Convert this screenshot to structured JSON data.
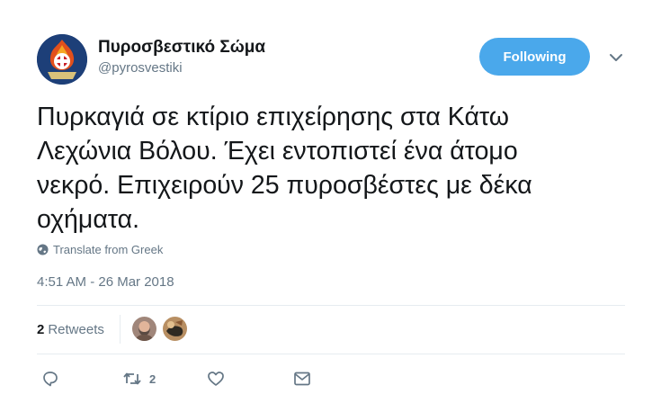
{
  "account": {
    "display_name": "Πυροσβεστικό Σώμα",
    "handle": "@pyrosvestiki"
  },
  "follow_button": {
    "label": "Following",
    "color": "#4aa8eb"
  },
  "tweet": {
    "text": "Πυρκαγιά σε κτίριο επιχείρησης στα Κάτω\nΛεχώνια Βόλου. Έχει εντοπιστεί  ένα άτομο\nνεκρό. Επιχειρούν 25 πυροσβέστες με δέκα\nοχήματα.",
    "translate_label": "Translate from Greek",
    "timestamp": "4:51 AM - 26 Mar 2018"
  },
  "stats": {
    "retweet_count": "2",
    "retweet_label": "Retweets"
  },
  "actions": {
    "retweet_count": "2"
  },
  "icons": {
    "caret": "chevron-down-icon",
    "translate": "globe-icon",
    "reply": "reply-icon",
    "retweet": "retweet-icon",
    "like": "heart-icon",
    "message": "envelope-icon"
  }
}
